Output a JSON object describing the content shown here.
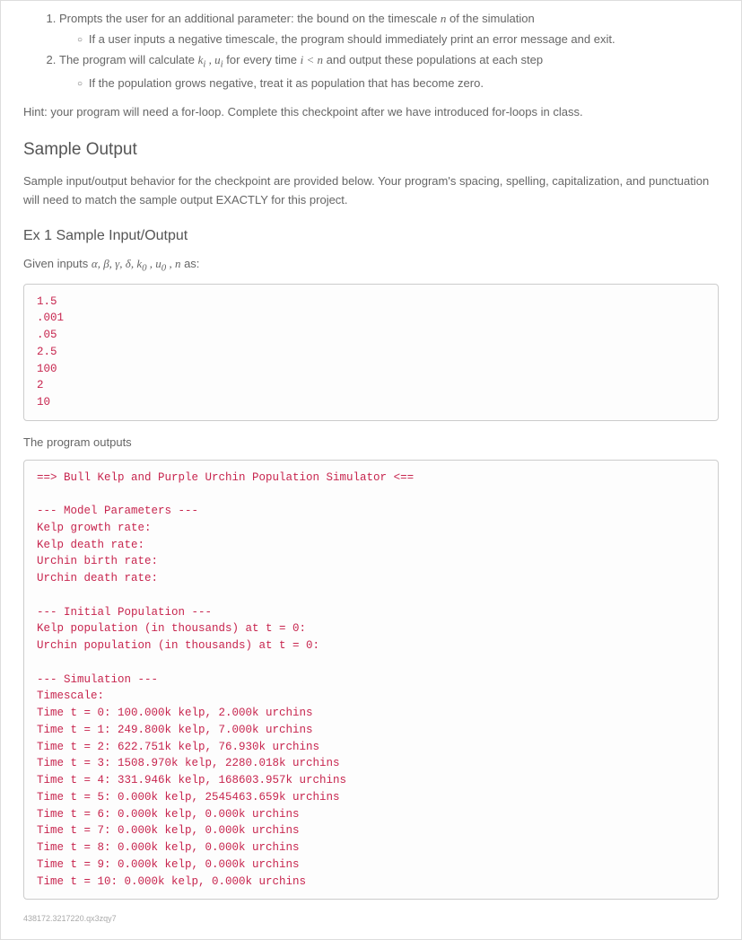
{
  "list": {
    "item1": "Prompts the user for an additional parameter: the bound on the timescale ",
    "item1b": " of the simulation",
    "item1sub": "If a user inputs a negative timescale, the program should immediately print an error message and exit.",
    "item2a": "The program will calculate ",
    "item2b": " for every time ",
    "item2c": " and output these populations at each step",
    "item2sub": "If the population grows negative, treat it as population that has become zero."
  },
  "hint": "Hint: your program will need a for-loop. Complete this checkpoint after we have introduced for-loops in class.",
  "h_sample_output": "Sample Output",
  "sample_desc": "Sample input/output behavior for the checkpoint are provided below. Your program's spacing, spelling, capitalization, and punctuation will need to match the sample output EXACTLY for this project.",
  "h_ex1": "Ex 1 Sample Input/Output",
  "given_inputs_a": "Given inputs ",
  "given_inputs_b": " as:",
  "inputs_block": "1.5\n.001\n.05\n2.5\n100\n2\n10",
  "program_outputs": "The program outputs",
  "output_block": "==> Bull Kelp and Purple Urchin Population Simulator <==\n\n--- Model Parameters ---\nKelp growth rate:\nKelp death rate:\nUrchin birth rate:\nUrchin death rate:\n\n--- Initial Population ---\nKelp population (in thousands) at t = 0:\nUrchin population (in thousands) at t = 0:\n\n--- Simulation ---\nTimescale:\nTime t = 0: 100.000k kelp, 2.000k urchins\nTime t = 1: 249.800k kelp, 7.000k urchins\nTime t = 2: 622.751k kelp, 76.930k urchins\nTime t = 3: 1508.970k kelp, 2280.018k urchins\nTime t = 4: 331.946k kelp, 168603.957k urchins\nTime t = 5: 0.000k kelp, 2545463.659k urchins\nTime t = 6: 0.000k kelp, 0.000k urchins\nTime t = 7: 0.000k kelp, 0.000k urchins\nTime t = 8: 0.000k kelp, 0.000k urchins\nTime t = 9: 0.000k kelp, 0.000k urchins\nTime t = 10: 0.000k kelp, 0.000k urchins",
  "footer": "438172.3217220.qx3zqy7"
}
